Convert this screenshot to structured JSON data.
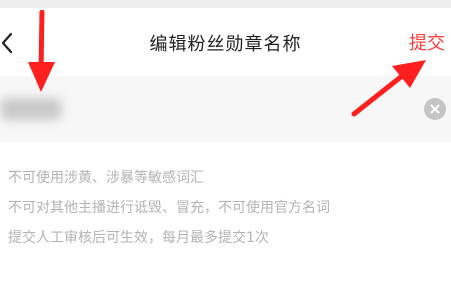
{
  "header": {
    "back_icon": "chevron-left-icon",
    "title": "编辑粉丝勋章名称",
    "submit_label": "提交"
  },
  "input": {
    "value": "",
    "clear_icon": "clear-icon"
  },
  "notes": [
    "不可使用涉黄、涉暴等敏感词汇",
    "不可对其他主播进行诋毁、冒充，不可使用官方名词",
    "提交人工审核后可生效，每月最多提交1次"
  ],
  "annotations": {
    "arrow_color": "#ff1f1f",
    "arrows": [
      "arrow-down-icon",
      "arrow-up-right-icon"
    ]
  },
  "colors": {
    "accent": "#ff3b3b",
    "title": "#222222",
    "hint": "#b3b3b3",
    "input_bg": "#f7f7f7"
  }
}
